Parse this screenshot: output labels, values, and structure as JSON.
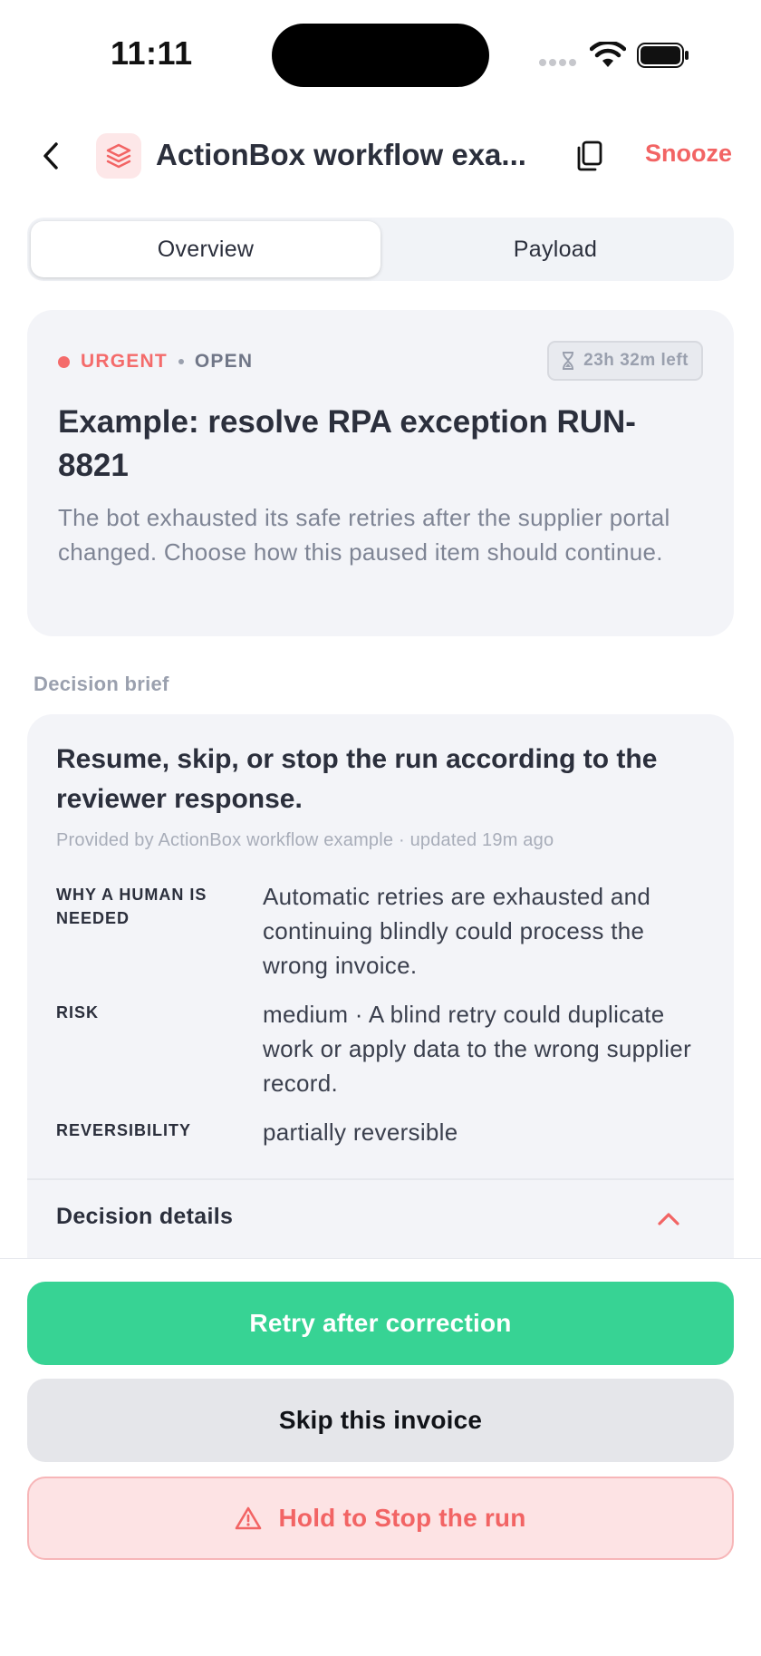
{
  "status_bar": {
    "time": "11:11"
  },
  "header": {
    "title": "ActionBox workflow exa...",
    "snooze_label": "Snooze"
  },
  "tabs": [
    {
      "label": "Overview",
      "active": true
    },
    {
      "label": "Payload",
      "active": false
    }
  ],
  "summary": {
    "priority": "URGENT",
    "state": "OPEN",
    "time_left": "23h 32m left",
    "title": "Example: resolve RPA exception RUN-8821",
    "description": "The bot exhausted its safe retries after the supplier portal changed. Choose how this paused item should continue."
  },
  "brief": {
    "section_label": "Decision brief",
    "title": "Resume, skip, or stop the run according to the reviewer response.",
    "meta": "Provided by ActionBox workflow example · updated 19m ago",
    "rows": [
      {
        "key": "WHY A HUMAN IS NEEDED",
        "value": "Automatic retries are exhausted and continuing blindly could process the wrong invoice."
      },
      {
        "key": "RISK",
        "value": "medium · A blind retry could duplicate work or apply data to the wrong supplier record."
      },
      {
        "key": "REVERSIBILITY",
        "value": "partially reversible"
      }
    ],
    "details_label": "Decision details"
  },
  "actions": {
    "primary": "Retry after correction",
    "secondary": "Skip this invoice",
    "danger": "Hold to Stop the run"
  },
  "colors": {
    "accent_red": "#f26464",
    "success_green": "#37d394",
    "card_bg": "#f3f4f8"
  }
}
